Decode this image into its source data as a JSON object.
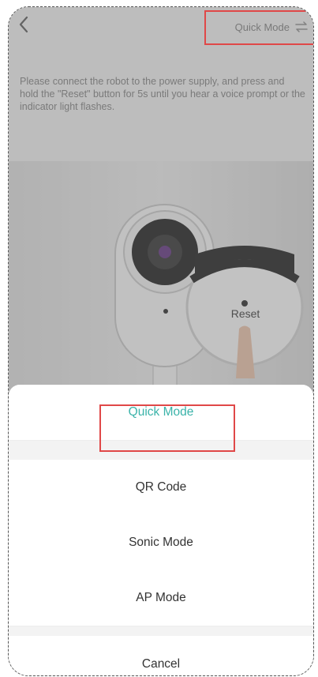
{
  "header": {
    "mode_link_label": "Quick Mode"
  },
  "instruction_text": "Please connect the robot to the power supply, and press and hold the \"Reset\" button for 5s until you hear a voice prompt or the indicator light flashes.",
  "illustration": {
    "reset_label": "Reset"
  },
  "sheet": {
    "options": [
      {
        "label": "Quick Mode",
        "selected": true
      },
      {
        "label": "QR Code",
        "selected": false
      },
      {
        "label": "Sonic Mode",
        "selected": false
      },
      {
        "label": "AP Mode",
        "selected": false
      }
    ],
    "cancel_label": "Cancel"
  },
  "colors": {
    "accent": "#3ab3a9",
    "highlight": "#e04848"
  }
}
